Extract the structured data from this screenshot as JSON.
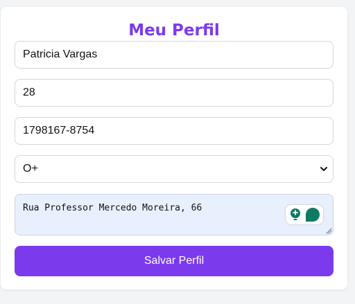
{
  "profile": {
    "title": "Meu Perfil",
    "name": "Patricia Vargas",
    "age": "28",
    "phone": "1798167-8754",
    "blood_type": "O+",
    "address": "Rua Professor Mercedo Moreira, 66",
    "save_label": "Salvar Perfil"
  },
  "colors": {
    "accent": "#7c3aed",
    "textarea_bg": "#e8f0fe",
    "extension_green": "#0e7a63"
  },
  "icons": {
    "select_arrow": "chevron-down-icon",
    "extension_badge": "extension-icon",
    "resize_handle": "resize-grip-icon"
  }
}
